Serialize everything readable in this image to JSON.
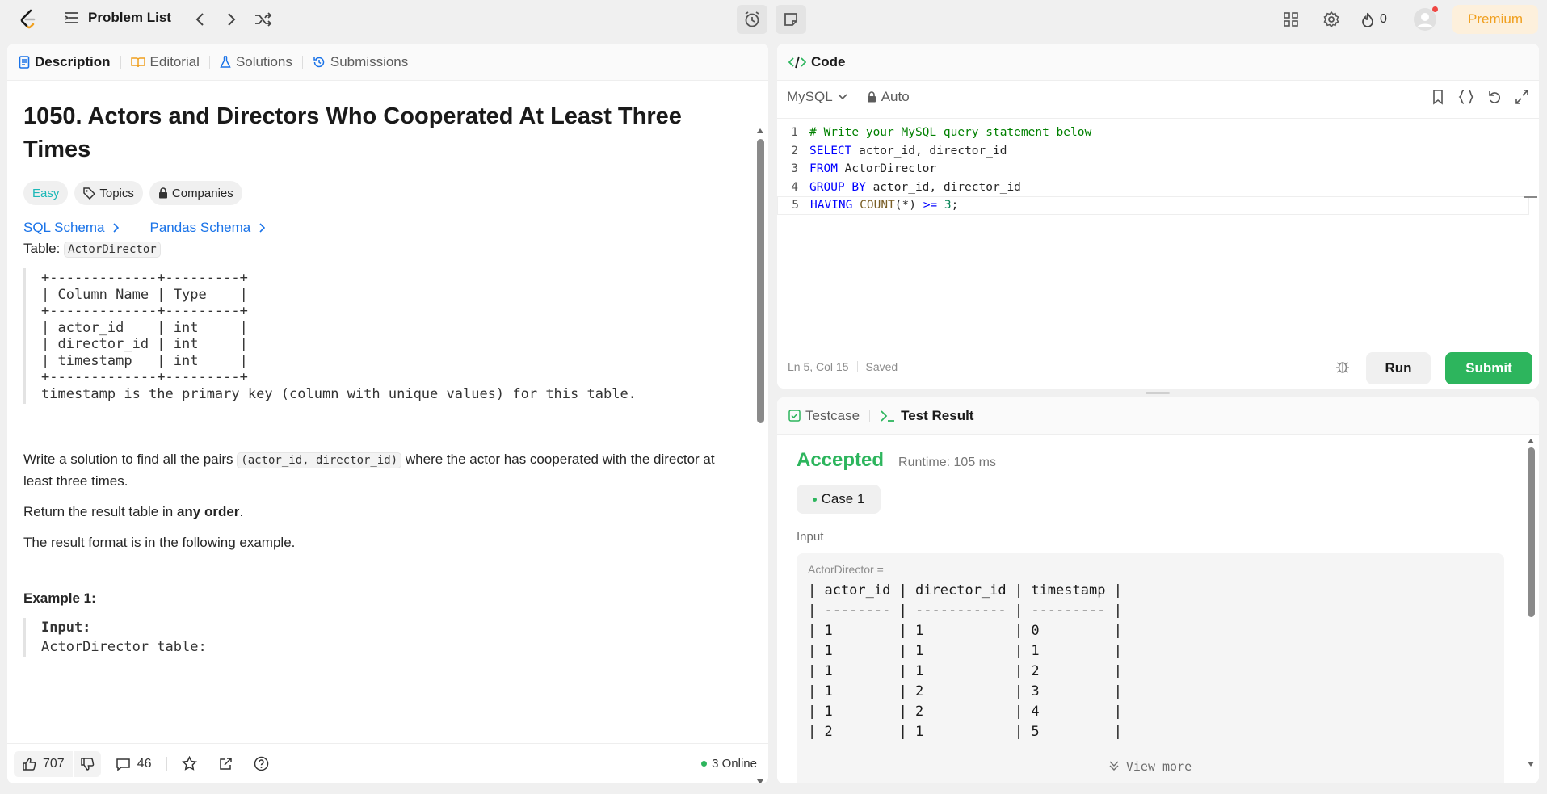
{
  "topbar": {
    "problem_list": "Problem List",
    "streak": "0",
    "premium": "Premium"
  },
  "left_tabs": [
    "Description",
    "Editorial",
    "Solutions",
    "Submissions"
  ],
  "problem": {
    "title": "1050. Actors and Directors Who Cooperated At Least Three Times",
    "difficulty": "Easy",
    "topics": "Topics",
    "companies": "Companies",
    "sql_schema": "SQL Schema",
    "pandas_schema": "Pandas Schema",
    "table_prefix": "Table:",
    "table_name": "ActorDirector",
    "schema_block": "+-------------+---------+\n| Column Name | Type    |\n+-------------+---------+\n| actor_id    | int     |\n| director_id | int     |\n| timestamp   | int     |\n+-------------+---------+\ntimestamp is the primary key (column with unique values) for this table.",
    "para1_before": "Write a solution to find all the pairs",
    "para1_code": "(actor_id, director_id)",
    "para1_after": "where the actor has cooperated with the director at least three times.",
    "para2_before": "Return the result table in",
    "para2_bold": "any order",
    "para2_after": ".",
    "para3": "The result format is in the following example.",
    "example_heading": "Example 1:",
    "example_input_label": "Input:",
    "example_input_line": "ActorDirector table:"
  },
  "footer": {
    "likes": "707",
    "comments": "46",
    "online": "3 Online"
  },
  "code": {
    "tab": "Code",
    "language": "MySQL",
    "mode": "Auto",
    "lines": [
      "# Write your MySQL query statement below",
      "SELECT actor_id, director_id",
      "FROM ActorDirector",
      "GROUP BY actor_id, director_id",
      "HAVING COUNT(*) >= 3;"
    ],
    "cursor": "Ln 5, Col 15",
    "saved": "Saved",
    "run": "Run",
    "submit": "Submit"
  },
  "result": {
    "tabs": [
      "Testcase",
      "Test Result"
    ],
    "status": "Accepted",
    "runtime": "Runtime: 105 ms",
    "case": "Case 1",
    "input_label": "Input",
    "var": "ActorDirector =",
    "table_lines": [
      "| actor_id | director_id | timestamp |",
      "| -------- | ----------- | --------- |",
      "| 1        | 1           | 0         |",
      "| 1        | 1           | 1         |",
      "| 1        | 1           | 2         |",
      "| 1        | 2           | 3         |",
      "| 1        | 2           | 4         |",
      "| 2        | 1           | 5         |"
    ],
    "view_more": "View more"
  }
}
